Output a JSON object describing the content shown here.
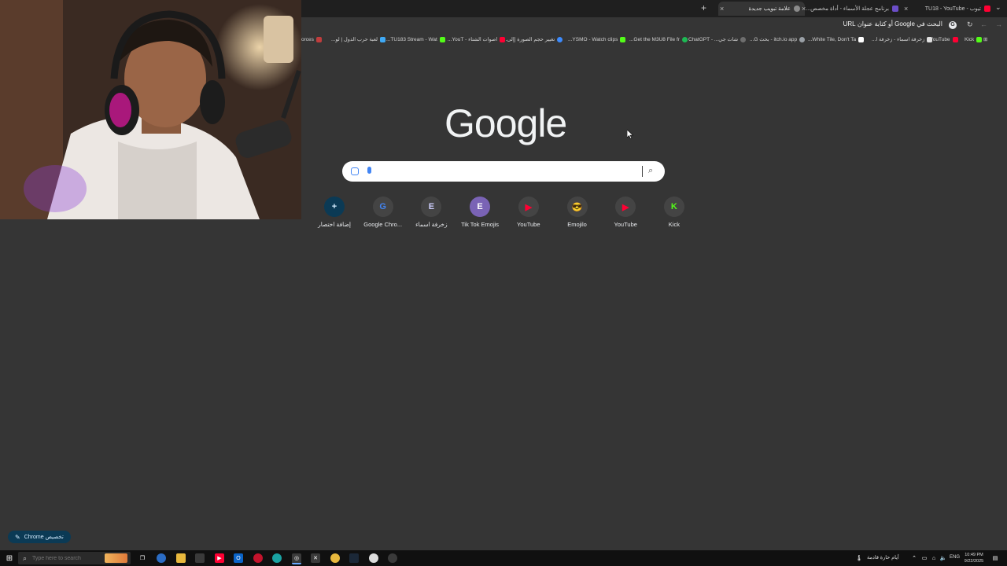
{
  "tabs": [
    {
      "title": "تيوب - TU18 - YouTube",
      "favicon_color": "#ff0033",
      "active": false
    },
    {
      "title": "برنامج عجلة الأسماء - أداة مخصص...",
      "favicon_color": "#6b4ec7",
      "active": false
    },
    {
      "title": "علامة تبويب جديدة",
      "favicon_color": "#8a8a8a",
      "active": true
    }
  ],
  "toolbar": {
    "omnibox_text": "البحث في Google أو كتابة عنوان URL"
  },
  "bookmarks": [
    {
      "label": "Kick",
      "color": "#53fc18"
    },
    {
      "label": "YouTube",
      "color": "#ff0033"
    },
    {
      "label": "زخرفة اسماء - زخرفة ا...",
      "color": "#e0e0e0"
    },
    {
      "label": "White Tile, Don't Ta...",
      "color": "#ffffff"
    },
    {
      "label": "itch.io app - بحث G...",
      "color": "#9aa0a6"
    },
    {
      "label": "شات جي... - ChatGPT",
      "color": "#6e6e6e"
    },
    {
      "label": "Get the M3U8 File fr...",
      "color": "#1db954"
    },
    {
      "label": "YSMO - Watch clips...",
      "color": "#53fc18"
    },
    {
      "label": "تغيير حجم الصورة [إلى...",
      "color": "#3d8bfd"
    },
    {
      "label": "اصوات الشتاء - YouT...",
      "color": "#ff0033"
    },
    {
      "label": "TU183 Stream - Wat...",
      "color": "#53fc18"
    },
    {
      "label": "لعبة حرب الدول | لو...",
      "color": "#3fa9f5"
    },
    {
      "label": "orces",
      "color": "#c03d3d"
    }
  ],
  "ntp": {
    "logo": "Google",
    "search_placeholder": "",
    "shortcuts": [
      {
        "label": "إضافة اختصار",
        "icon": "add-icon",
        "glyph": "+",
        "color": "#0b3a55",
        "glyph_color": "#d4ecff"
      },
      {
        "label": "Google Chro...",
        "icon": "google-g-icon",
        "glyph": "G",
        "color": "#444",
        "glyph_color": "#4285f4"
      },
      {
        "label": "زخرفة اسماء",
        "icon": "letter-e-icon",
        "glyph": "E",
        "color": "#444",
        "glyph_color": "#cfd0ff"
      },
      {
        "label": "Tik Tok Emojis",
        "icon": "letter-e-icon",
        "glyph": "E",
        "color": "#7a63b5",
        "glyph_color": "#ffffff"
      },
      {
        "label": "YouTube",
        "icon": "youtube-icon",
        "glyph": "▶",
        "color": "#444",
        "glyph_color": "#ff0033"
      },
      {
        "label": "Emojilo",
        "icon": "emoji-sunglasses-icon",
        "glyph": "😎",
        "color": "#444",
        "glyph_color": "#f5c518"
      },
      {
        "label": "YouTube",
        "icon": "youtube-icon",
        "glyph": "▶",
        "color": "#444",
        "glyph_color": "#ff0033"
      },
      {
        "label": "Kick",
        "icon": "kick-icon",
        "glyph": "K",
        "color": "#444",
        "glyph_color": "#53fc18"
      }
    ],
    "customize_label": "تخصيص Chrome"
  },
  "taskbar": {
    "search_placeholder": "Type here to search",
    "weather": "أيام حارة قادمة",
    "lang": "ENG",
    "time": "10:49 PM",
    "date": "9/22/2025"
  }
}
